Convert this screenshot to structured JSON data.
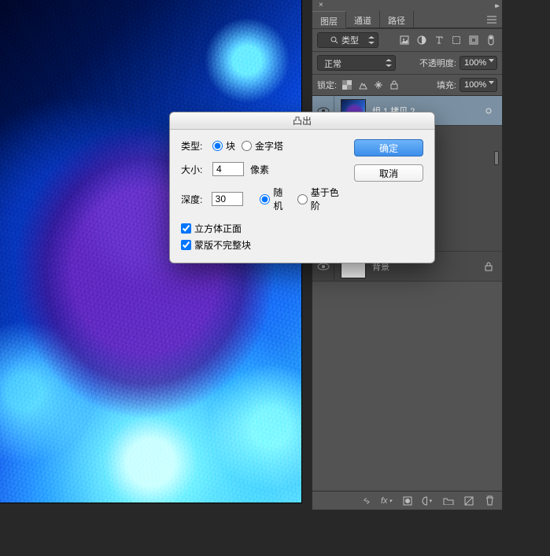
{
  "panel": {
    "close_glyph": "×",
    "collapse_glyph": "▸▸",
    "tabs": {
      "layers": "图层",
      "channels": "通道",
      "paths": "路径"
    },
    "kind_filter": {
      "label": "类型"
    },
    "blend": {
      "mode": "正常",
      "opacity_label": "不透明度:",
      "opacity_value": "100%"
    },
    "lock": {
      "label": "锁定:",
      "fill_label": "填充:",
      "fill_value": "100%"
    },
    "layers": {
      "item1_name": "组 1 拷贝 2",
      "bg_name": "背景"
    }
  },
  "dialog": {
    "title": "凸出",
    "type_label": "类型:",
    "type_block": "块",
    "type_pyramid": "金字塔",
    "size_label": "大小:",
    "size_value": "4",
    "size_unit": "像素",
    "depth_label": "深度:",
    "depth_value": "30",
    "depth_random": "随机",
    "depth_level": "基于色阶",
    "cb_solid": "立方体正面",
    "cb_mask": "蒙版不完整块",
    "ok": "确定",
    "cancel": "取消"
  }
}
